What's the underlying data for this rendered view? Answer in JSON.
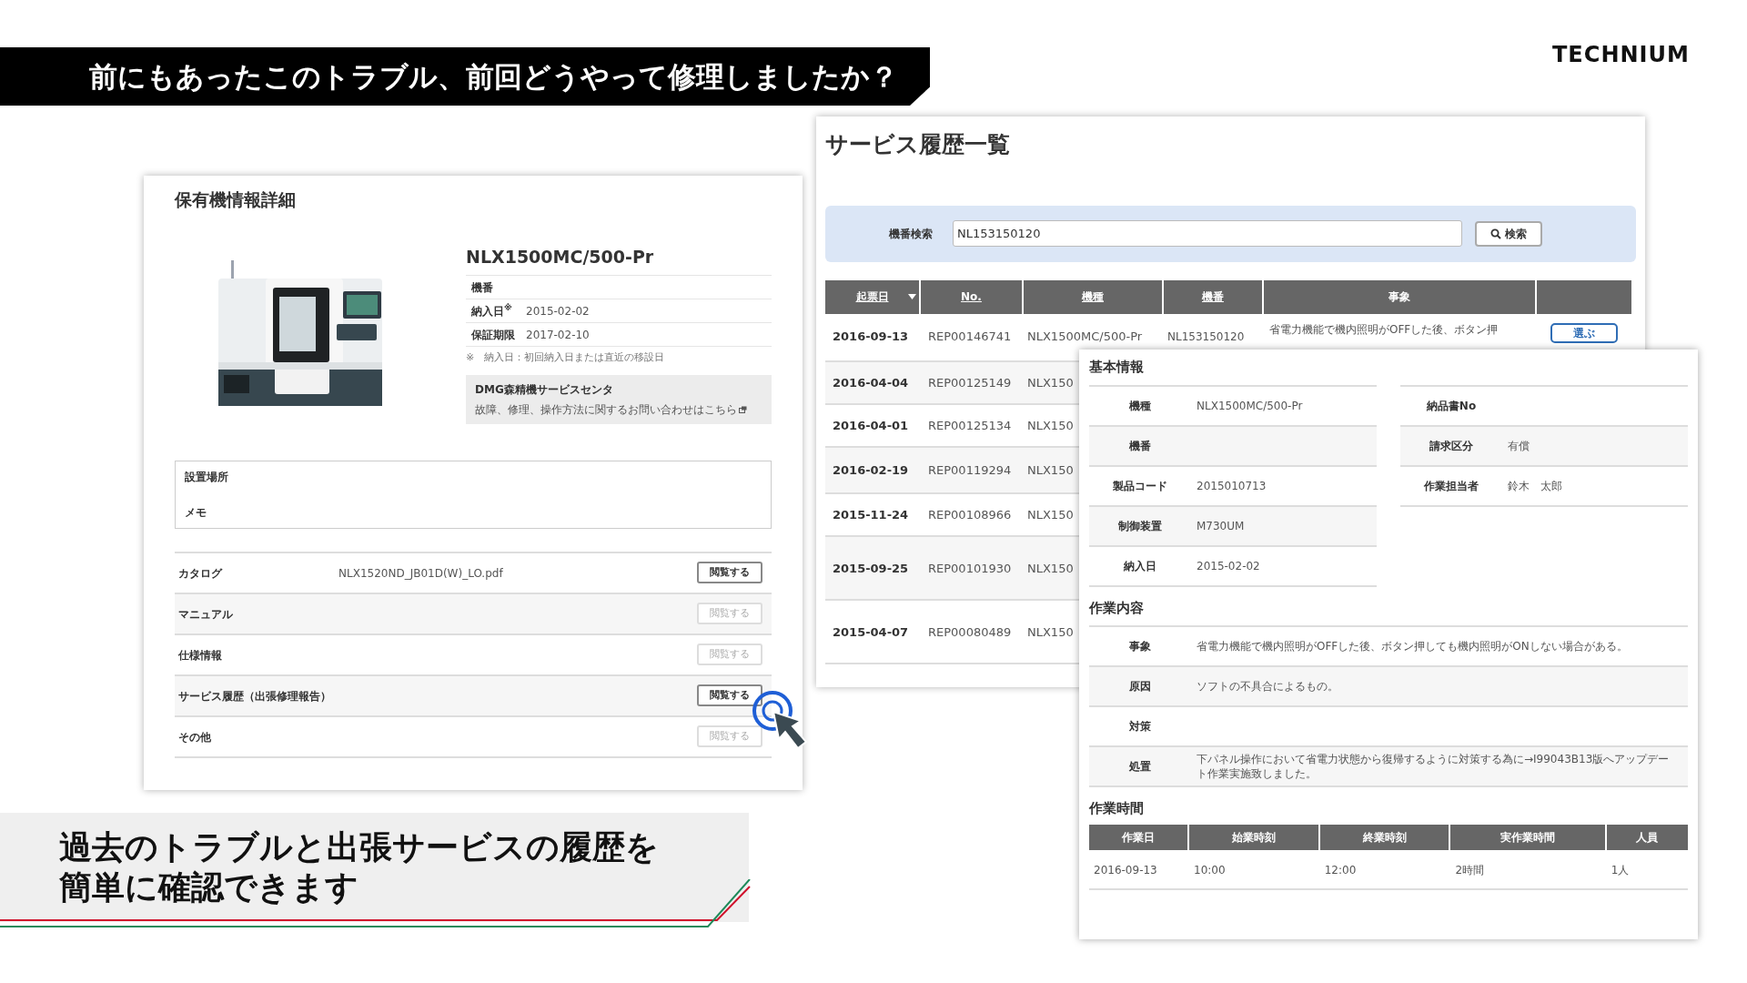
{
  "headline": "前にもあったこのトラブル、前回どうやって修理しましたか？",
  "logo": "TECHNIUM",
  "machine_panel": {
    "title": "保有機情報詳細",
    "model": "NLX1500MC/500-Pr",
    "specs": [
      {
        "label": "機番"
      },
      {
        "label": "納入日$^{※}$",
        "value": "2015-02-02"
      },
      {
        "label": "保証期限",
        "value": "2017-02-10"
      }
    ],
    "footnote": "※　納入日：初回納入日または直近の移設日",
    "service_center": {
      "name": "DMG森精機サービスセンタ",
      "link": "故障、修理、操作方法に関するお問い合わせはこちら"
    },
    "notes": [
      "設置場所",
      "メモ"
    ],
    "documents": [
      {
        "label": "カタログ",
        "file": "NLX1520ND_JB01D(W)_LO.pdf",
        "button": "閲覧する",
        "disabled": false
      },
      {
        "label": "マニュアル",
        "button": "閲覧する",
        "disabled": true
      },
      {
        "label": "仕様情報",
        "button": "閲覧する",
        "disabled": true
      },
      {
        "label": "サービス履歴（出張修理報告）",
        "button": "閲覧する",
        "disabled": false
      },
      {
        "label": "その他",
        "button": "閲覧する",
        "disabled": true
      }
    ]
  },
  "history": {
    "title": "サービス履歴一覧",
    "search": {
      "label": "機番検索",
      "value": "NL153150120",
      "button": "検索"
    },
    "columns": [
      {
        "label": "起票日",
        "sortable": true,
        "sorted": true
      },
      {
        "label": "No.",
        "sortable": true,
        "sorted": false
      },
      {
        "label": "機種",
        "sortable": true,
        "sorted": false
      },
      {
        "label": "機番",
        "sortable": true,
        "sorted": false
      },
      {
        "label": "事象",
        "sortable": false,
        "sorted": false
      }
    ],
    "rows": [
      {
        "date": "2016-09-13",
        "no": "REP00146741",
        "model": "NLX1500MC/500-Pr",
        "serial": "NL153150120",
        "event": "省電力機能で機内照明がOFFした後、ボタン押",
        "button": "選ぶ"
      },
      {
        "date": "2016-04-04",
        "no": "REP00125149",
        "model": "NLX150"
      },
      {
        "date": "2016-04-01",
        "no": "REP00125134",
        "model": "NLX150"
      },
      {
        "date": "2016-02-19",
        "no": "REP00119294",
        "model": "NLX150"
      },
      {
        "date": "2015-11-24",
        "no": "REP00108966",
        "model": "NLX150"
      },
      {
        "date": "2015-09-25",
        "no": "REP00101930",
        "model": "NLX150"
      },
      {
        "date": "2015-04-07",
        "no": "REP00080489",
        "model": "NLX150"
      }
    ]
  },
  "detail": {
    "basic_title": "基本情報",
    "basic_left": [
      {
        "label": "機種",
        "value": "NLX1500MC/500-Pr"
      },
      {
        "label": "機番"
      },
      {
        "label": "製品コード",
        "value": "2015010713"
      },
      {
        "label": "制御装置",
        "value": "M730UM"
      },
      {
        "label": "納入日",
        "value": "2015-02-02"
      }
    ],
    "basic_right": [
      {
        "label": "納品書No"
      },
      {
        "label": "請求区分",
        "value": "有償"
      },
      {
        "label": "作業担当者",
        "value": "鈴木　太郎"
      }
    ],
    "work_title": "作業内容",
    "work": [
      {
        "label": "事象",
        "value": "省電力機能で機内照明がOFFした後、ボタン押しても機内照明がONしない場合がある。"
      },
      {
        "label": "原因",
        "value": "ソフトの不具合によるもの。"
      },
      {
        "label": "対策"
      },
      {
        "label": "処置",
        "value": "下パネル操作において省電力状態から復帰するように対策する為に→I99043B13版へアップデート作業実施致しました。"
      }
    ],
    "time_title": "作業時間",
    "time_columns": [
      "作業日",
      "始業時刻",
      "終業時刻",
      "実作業時間",
      "人員"
    ],
    "time_rows": [
      [
        "2016-09-13",
        "10:00",
        "12:00",
        "2時間",
        "1人"
      ]
    ]
  },
  "caption": [
    "過去のトラブルと出張サービスの履歴を",
    "簡単に確認できます"
  ]
}
